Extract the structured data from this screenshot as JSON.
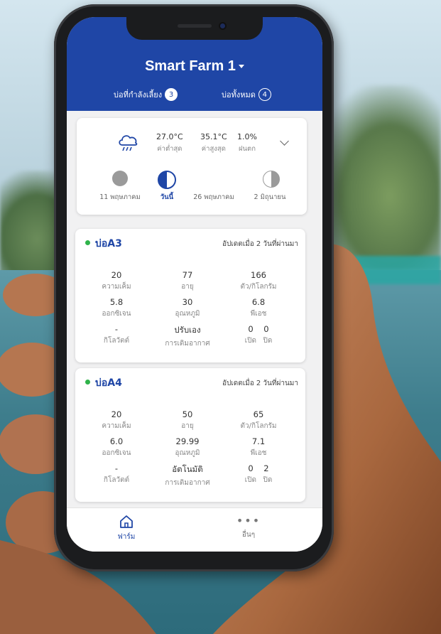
{
  "header": {
    "title": "Smart Farm 1",
    "tabs": [
      {
        "label": "บ่อที่กำลังเลี้ยง",
        "count": "3"
      },
      {
        "label": "บ่อทั้งหมด",
        "count": "4"
      }
    ]
  },
  "weather": {
    "icon": "rain-cloud-icon",
    "stats": [
      {
        "value": "27.0°C",
        "label": "ค่าต่ำสุด"
      },
      {
        "value": "35.1°C",
        "label": "ค่าสูงสุด"
      },
      {
        "value": "1.0%",
        "label": "ฝนตก"
      }
    ],
    "moon_phases": [
      {
        "label": "11 พฤษภาคม",
        "phase": "new-moon"
      },
      {
        "label": "วันนี้",
        "phase": "first-quarter"
      },
      {
        "label": "26 พฤษภาคม",
        "phase": "full-moon"
      },
      {
        "label": "2 มิถุนายน",
        "phase": "last-quarter"
      }
    ]
  },
  "ponds": [
    {
      "name": "บ่อA3",
      "updated": "อัปเดตเมื่อ 2 วันที่ผ่านมา",
      "metrics": [
        {
          "value": "20",
          "label": "ความเค็ม"
        },
        {
          "value": "77",
          "label": "อายุ"
        },
        {
          "value": "166",
          "label": "ตัว/กิโลกรัม"
        },
        {
          "value": "5.8",
          "label": "ออกซิเจน"
        },
        {
          "value": "30",
          "label": "อุณหภูมิ"
        },
        {
          "value": "6.8",
          "label": "พีเอช"
        },
        {
          "value": "-",
          "label": "กิโลวัตต์"
        },
        {
          "value": "ปรับเอง",
          "label": "การเติมอากาศ"
        },
        {
          "value": "0    0",
          "label": "เปิด   ปิด"
        }
      ]
    },
    {
      "name": "บ่อA4",
      "updated": "อัปเดตเมื่อ 2 วันที่ผ่านมา",
      "metrics": [
        {
          "value": "20",
          "label": "ความเค็ม"
        },
        {
          "value": "50",
          "label": "อายุ"
        },
        {
          "value": "65",
          "label": "ตัว/กิโลกรัม"
        },
        {
          "value": "6.0",
          "label": "ออกซิเจน"
        },
        {
          "value": "29.99",
          "label": "อุณหภูมิ"
        },
        {
          "value": "7.1",
          "label": "พีเอช"
        },
        {
          "value": "-",
          "label": "กิโลวัตต์"
        },
        {
          "value": "อัตโนมัติ",
          "label": "การเติมอากาศ"
        },
        {
          "value": "0    2",
          "label": "เปิด   ปิด"
        }
      ]
    }
  ],
  "nav": {
    "farm": "ฟาร์ม",
    "more": "อื่นๆ"
  },
  "colors": {
    "brand": "#1f46a6",
    "status_dot": "#2fb34a"
  }
}
